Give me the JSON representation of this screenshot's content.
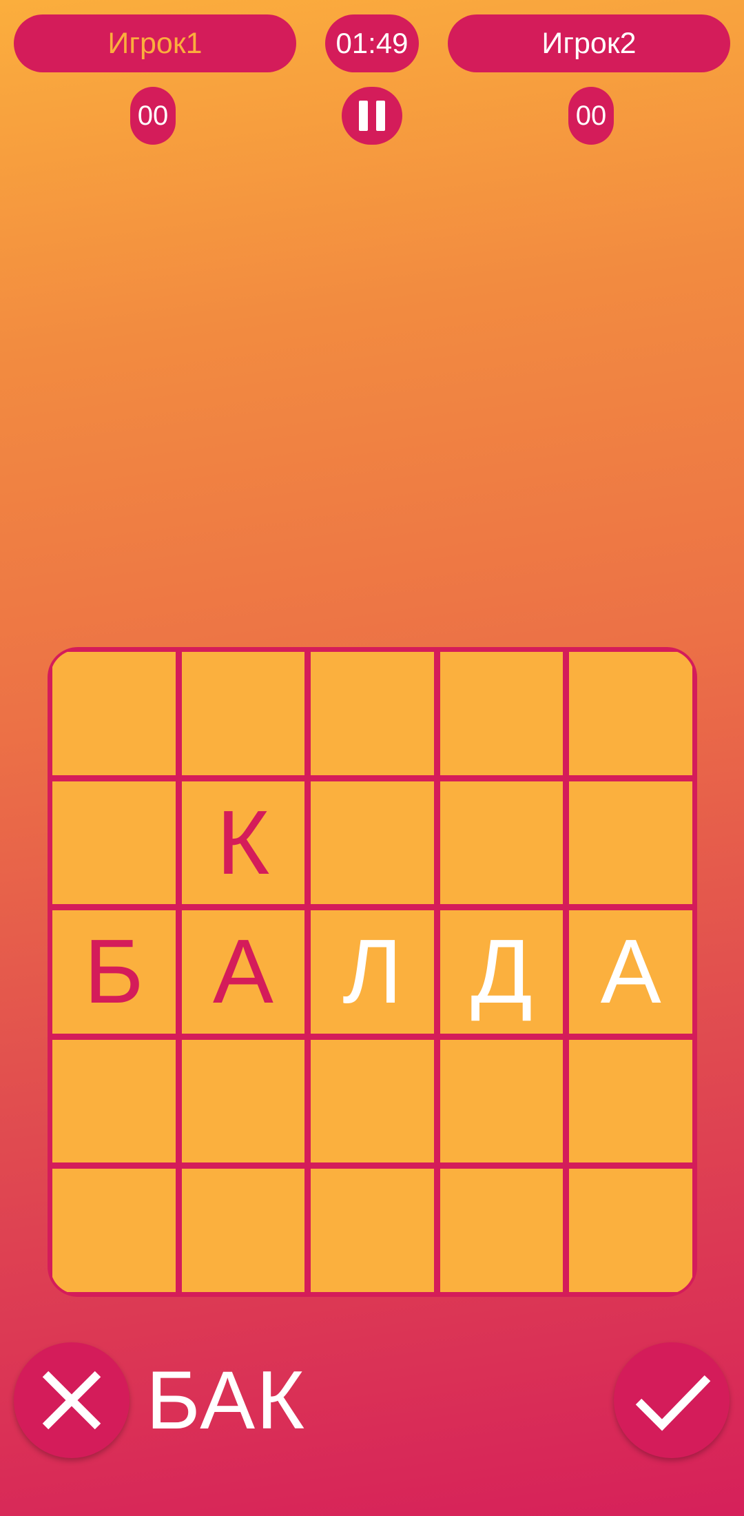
{
  "header": {
    "player1_name": "Игрок1",
    "player2_name": "Игрок2",
    "timer": "01:49",
    "player1_score": "00",
    "player2_score": "00"
  },
  "board": {
    "rows": [
      [
        "",
        "",
        "",
        "",
        ""
      ],
      [
        "",
        "К",
        "",
        "",
        ""
      ],
      [
        "Б",
        "А",
        "Л",
        "Д",
        "А"
      ],
      [
        "",
        "",
        "",
        "",
        ""
      ],
      [
        "",
        "",
        "",
        "",
        ""
      ]
    ],
    "new_letter_cells": [
      [
        2,
        2
      ],
      [
        2,
        3
      ],
      [
        2,
        4
      ]
    ]
  },
  "footer": {
    "current_word": "БАК"
  },
  "colors": {
    "accent": "#d41c5a",
    "cell": "#fbb03e",
    "active_player": "#fbae3d"
  },
  "icons": {
    "pause": "pause-icon",
    "cancel": "close-icon",
    "confirm": "check-icon"
  }
}
